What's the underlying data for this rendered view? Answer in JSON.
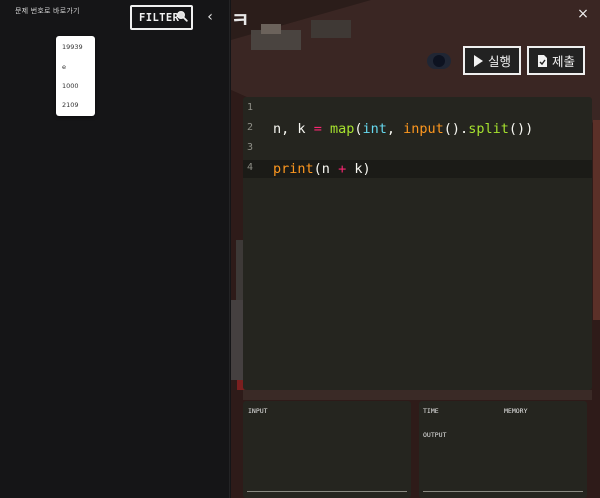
{
  "sidebar": {
    "goto_label": "문제 번호로 바로가기",
    "filter_label": "FILTER",
    "collapse_glyph": "‹",
    "suggestions": [
      "19939",
      "e",
      "1000",
      "2109"
    ]
  },
  "main": {
    "scene_glyph": "ㅋ",
    "close_glyph": "×",
    "run_label": "실행",
    "submit_label": "제출"
  },
  "editor": {
    "lines": [
      {
        "no": "1",
        "text": ""
      },
      {
        "no": "2",
        "text": "n, k = map(int, input().split())"
      },
      {
        "no": "3",
        "text": ""
      },
      {
        "no": "4",
        "text": "print(n + k)"
      }
    ],
    "active_line": 4
  },
  "panels": {
    "input_label": "INPUT",
    "time_label": "TIME",
    "memory_label": "MEMORY",
    "output_label": "OUTPUT"
  },
  "colors": {
    "sidebar_bg": "#151517",
    "editor_bg": "#25251f",
    "keyword": "#f92672",
    "function": "#a6e22e",
    "builtin": "#fd971f",
    "type": "#66d9ef"
  }
}
